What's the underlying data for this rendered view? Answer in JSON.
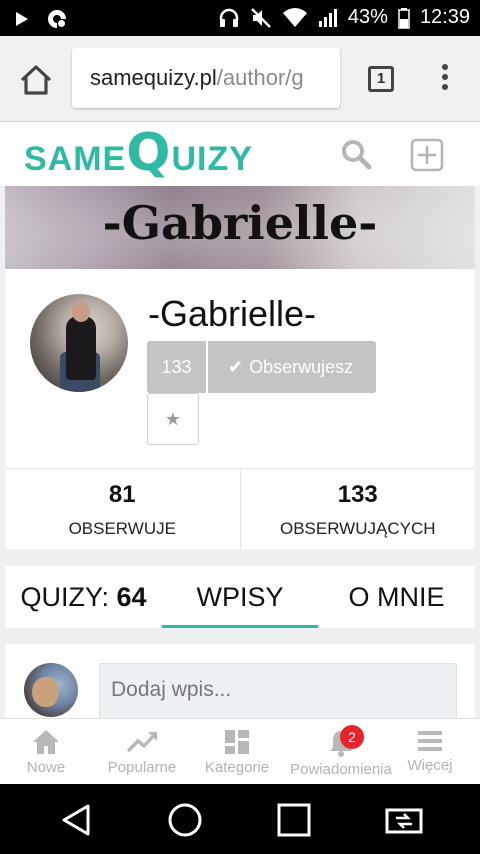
{
  "status_bar": {
    "battery_percent": "43%",
    "time": "12:39",
    "icons": [
      "play-icon",
      "sync-icon",
      "headphones-icon",
      "mute-icon",
      "wifi-icon",
      "signal-icon",
      "battery-icon"
    ]
  },
  "browser": {
    "url_domain": "samequizy.pl",
    "url_path": "/author/g",
    "tab_count": "1",
    "icons": [
      "home-icon",
      "tabs-icon",
      "more-vert-icon"
    ]
  },
  "site_header": {
    "logo_same": "SAME",
    "logo_q": "Q",
    "logo_rest": "UIZY",
    "icons": [
      "search-icon",
      "add-icon"
    ],
    "accent_color": "#2fbaa5"
  },
  "cover": {
    "title": "-Gabrielle-"
  },
  "profile": {
    "name": "-Gabrielle-",
    "follower_button_count": "133",
    "follow_button_label": "Obserwujesz",
    "stats": [
      {
        "value": "81",
        "label": "OBSERWUJE"
      },
      {
        "value": "133",
        "label": "OBSERWUJĄCYCH"
      }
    ]
  },
  "tabs": {
    "quizy_label": "QUIZY:",
    "quizy_count": "64",
    "posts_label": "WPISY",
    "about_label": "O MNIE",
    "active": "WPISY"
  },
  "post_box": {
    "placeholder": "Dodaj wpis..."
  },
  "app_nav": {
    "items": [
      {
        "label": "Nowe",
        "icon": "home-icon"
      },
      {
        "label": "Popularne",
        "icon": "trending-icon"
      },
      {
        "label": "Kategorie",
        "icon": "grid-icon"
      },
      {
        "label": "Powiadomienia",
        "icon": "bell-icon"
      },
      {
        "label": "Więcej",
        "icon": "menu-icon"
      }
    ],
    "notification_badge": "2",
    "badge_color": "#e8232a"
  },
  "system_nav": {
    "icons": [
      "back-icon",
      "home-circle-icon",
      "recents-icon",
      "screen-share-icon"
    ]
  }
}
